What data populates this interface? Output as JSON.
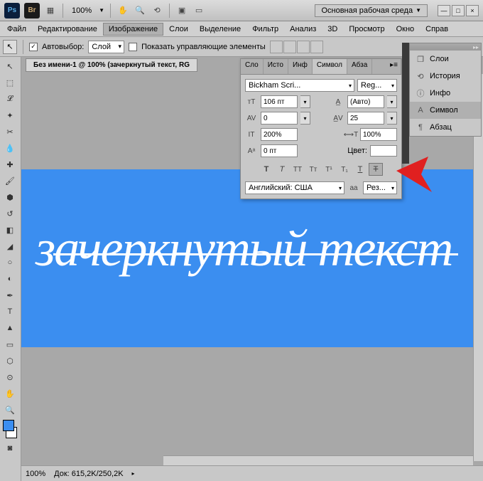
{
  "topbar": {
    "zoom": "100%",
    "workspace": "Основная рабочая среда"
  },
  "menu": {
    "file": "Файл",
    "edit": "Редактирование",
    "image": "Изображение",
    "layer": "Слои",
    "select": "Выделение",
    "filter": "Фильтр",
    "analysis": "Анализ",
    "threeDee": "3D",
    "view": "Просмотр",
    "window": "Окно",
    "help": "Справ"
  },
  "options": {
    "autoselect": "Автовыбор:",
    "layer": "Слой",
    "show_transform": "Показать управляющие элементы"
  },
  "document": {
    "tab_title": "Без имени-1 @ 100% (зачеркнутый текст, RG",
    "canvas_text": "зачеркнутый текст"
  },
  "char_panel": {
    "tabs": {
      "layers": "Сло",
      "history": "Исто",
      "info": "Инф",
      "character": "Символ",
      "paragraph": "Абза"
    },
    "font": "Bickham Scri...",
    "style": "Reg...",
    "size": "106 пт",
    "leading": "(Авто)",
    "kerning": "0",
    "tracking": "25",
    "vscale": "200%",
    "hscale": "100%",
    "baseline": "0 пт",
    "color_label": "Цвет:",
    "lang": "Английский: США",
    "aa": "aа",
    "sharp": "Рез..."
  },
  "side_panel": {
    "layers": "Слои",
    "history": "История",
    "info": "Инфо",
    "character": "Символ",
    "paragraph": "Абзац"
  },
  "status": {
    "zoom": "100%",
    "doc": "Док: 615,2K/250,2K"
  }
}
